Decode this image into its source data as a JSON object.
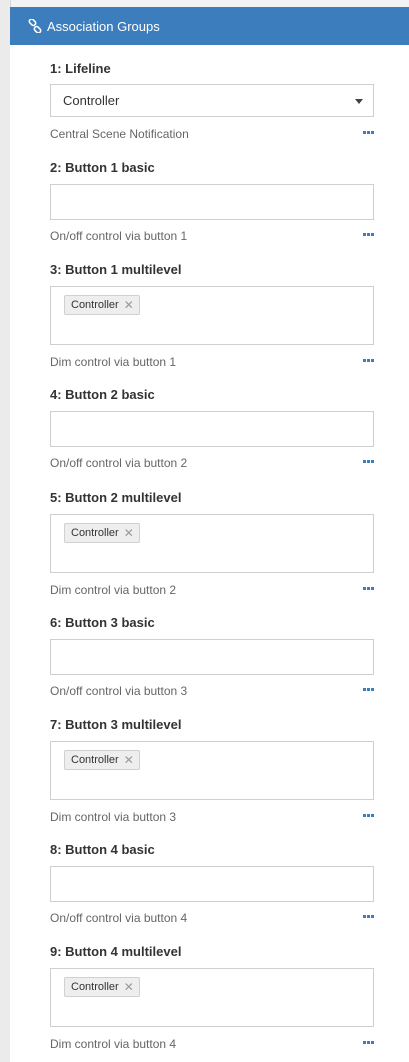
{
  "header": {
    "title": "Association Groups"
  },
  "groups": [
    {
      "title": "1: Lifeline",
      "type": "select",
      "value": "Controller",
      "description": "Central Scene Notification"
    },
    {
      "title": "2: Button 1 basic",
      "type": "basic",
      "description": "On/off control via button 1"
    },
    {
      "title": "3: Button 1 multilevel",
      "type": "multi",
      "tag": "Controller",
      "description": "Dim control via button 1"
    },
    {
      "title": "4: Button 2 basic",
      "type": "basic",
      "description": "On/off control via button 2"
    },
    {
      "title": "5: Button 2 multilevel",
      "type": "multi",
      "tag": "Controller",
      "description": "Dim control via button 2"
    },
    {
      "title": "6: Button 3 basic",
      "type": "basic",
      "description": "On/off control via button 3"
    },
    {
      "title": "7: Button 3 multilevel",
      "type": "multi",
      "tag": "Controller",
      "description": "Dim control via button 3"
    },
    {
      "title": "8: Button 4 basic",
      "type": "basic",
      "description": "On/off control via button 4"
    },
    {
      "title": "9: Button 4 multilevel",
      "type": "multi",
      "tag": "Controller",
      "description": "Dim control via button 4"
    }
  ],
  "icons": {
    "header": "link-icon",
    "more": "more-dots-icon",
    "remove": "remove-x-icon",
    "caret": "caret-down-icon"
  },
  "colors": {
    "accent": "#3b7dbd"
  }
}
